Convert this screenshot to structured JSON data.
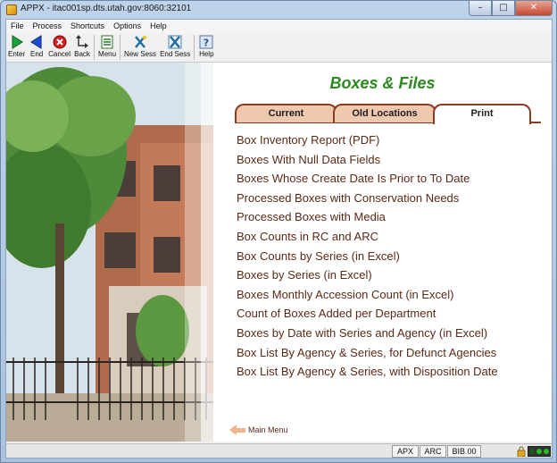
{
  "window": {
    "title": "APPX - itac001sp.dts.utah.gov:8060:32101",
    "controls": {
      "minimize": "–",
      "maximize": "□",
      "close": "✕"
    }
  },
  "menubar": [
    "File",
    "Process",
    "Shortcuts",
    "Options",
    "Help"
  ],
  "toolbar": [
    {
      "label": "Enter",
      "icon": "enter-icon"
    },
    {
      "label": "End",
      "icon": "end-icon"
    },
    {
      "label": "Cancel",
      "icon": "cancel-icon"
    },
    {
      "label": "Back",
      "icon": "back-icon"
    },
    {
      "label": "Menu",
      "icon": "menu-icon"
    },
    {
      "label": "New Sess",
      "icon": "new-session-icon"
    },
    {
      "label": "End Sess",
      "icon": "end-session-icon"
    },
    {
      "label": "Help",
      "icon": "help-icon"
    }
  ],
  "page": {
    "title": "Boxes & Files",
    "tabs": [
      {
        "label": "Current",
        "active": false
      },
      {
        "label": "Old Locations",
        "active": false
      },
      {
        "label": "Print",
        "active": true
      }
    ],
    "links": [
      "Box Inventory Report (PDF)",
      "Boxes With Null Data Fields",
      "Boxes Whose Create Date Is Prior to To Date",
      "Processed Boxes with Conservation Needs",
      "Processed Boxes with Media",
      "Box Counts in RC and ARC",
      "Box Counts by Series (in Excel)",
      "Boxes by Series (in Excel)",
      "Boxes Monthly Accession Count (in Excel)",
      "Count of Boxes Added per Department",
      "Boxes by Date with Series and Agency (in Excel)",
      "Box List By Agency & Series, for Defunct Agencies",
      "Box List By Agency & Series, with Disposition Date"
    ],
    "main_menu_label": "Main Menu"
  },
  "statusbar": {
    "cells": [
      "APX",
      "ARC",
      "BIB 00"
    ]
  },
  "colors": {
    "title_green": "#2a8a1f",
    "link_brown": "#5a2a15",
    "tab_border": "#8b3b1f",
    "tab_fill": "#efc8b0"
  }
}
